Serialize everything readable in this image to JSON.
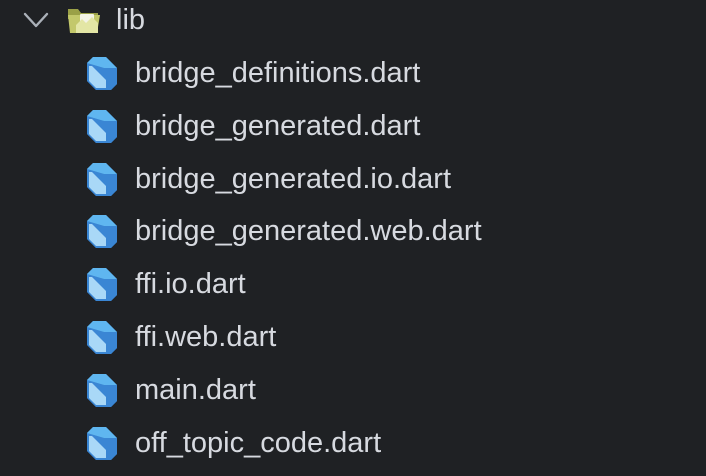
{
  "explorer": {
    "folder": {
      "name": "lib",
      "expanded": true,
      "icon": "folder-open-icon",
      "icon_color": "#c3c86b"
    },
    "files": [
      {
        "name": "bridge_definitions.dart",
        "icon": "dart-icon"
      },
      {
        "name": "bridge_generated.dart",
        "icon": "dart-icon"
      },
      {
        "name": "bridge_generated.io.dart",
        "icon": "dart-icon"
      },
      {
        "name": "bridge_generated.web.dart",
        "icon": "dart-icon"
      },
      {
        "name": "ffi.io.dart",
        "icon": "dart-icon"
      },
      {
        "name": "ffi.web.dart",
        "icon": "dart-icon"
      },
      {
        "name": "main.dart",
        "icon": "dart-icon"
      },
      {
        "name": "off_topic_code.dart",
        "icon": "dart-icon"
      }
    ],
    "colors": {
      "background": "#1f2124",
      "text": "#d7dae0",
      "dart_light": "#5fb6f0",
      "dart_dark": "#2b6fb8",
      "chevron": "#aab0b8"
    }
  }
}
